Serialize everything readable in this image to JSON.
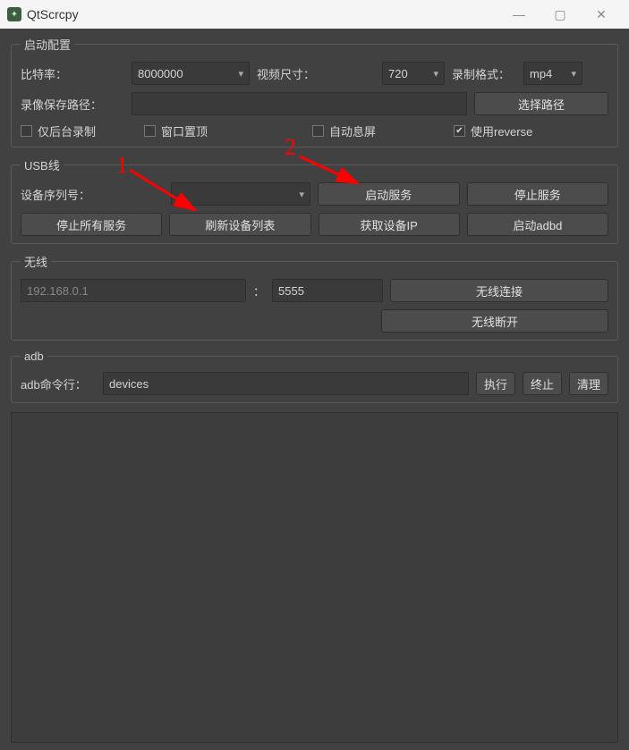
{
  "app": {
    "title": "QtScrcpy"
  },
  "startup": {
    "legend": "启动配置",
    "bitrate_label": "比特率：",
    "bitrate_value": "8000000",
    "videosize_label": "视频尺寸：",
    "videosize_value": "720",
    "recordfmt_label": "录制格式：",
    "recordfmt_value": "mp4",
    "savepath_label": "录像保存路径：",
    "savepath_value": "",
    "choosepath_btn": "选择路径",
    "chk_background": "仅后台录制",
    "chk_topmost": "窗口置顶",
    "chk_autosleep": "自动息屏",
    "chk_reverse": "使用reverse"
  },
  "usb": {
    "legend": "USB线",
    "serial_label": "设备序列号：",
    "serial_value": "",
    "start_service": "启动服务",
    "stop_service": "停止服务",
    "stop_all": "停止所有服务",
    "refresh": "刷新设备列表",
    "get_ip": "获取设备IP",
    "start_adbd": "启动adbd"
  },
  "wireless": {
    "legend": "无线",
    "ip_placeholder": "192.168.0.1",
    "port_value": "5555",
    "colon": "：",
    "connect": "无线连接",
    "disconnect": "无线断开"
  },
  "adb": {
    "legend": "adb",
    "cmd_label": "adb命令行：",
    "cmd_value": "devices",
    "execute": "执行",
    "stop": "终止",
    "clear": "清理"
  },
  "annotations": {
    "num1": "1",
    "num2": "2"
  }
}
